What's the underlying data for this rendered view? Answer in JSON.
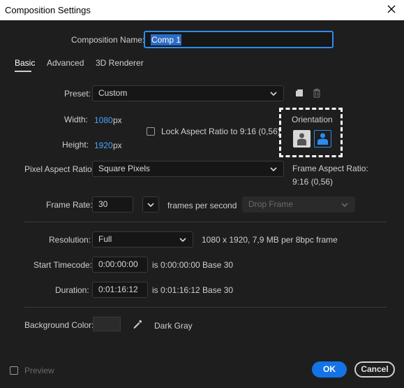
{
  "window": {
    "title": "Composition Settings"
  },
  "comp_name": {
    "label": "Composition Name:",
    "value": "Comp 1"
  },
  "tabs": [
    {
      "label": "Basic"
    },
    {
      "label": "Advanced"
    },
    {
      "label": "3D Renderer"
    }
  ],
  "preset": {
    "label": "Preset:",
    "value": "Custom"
  },
  "width": {
    "label": "Width:",
    "value": "1080",
    "unit": "px"
  },
  "height": {
    "label": "Height:",
    "value": "1920",
    "unit": "px"
  },
  "lock_aspect": {
    "label": "Lock Aspect Ratio to 9:16 (0,56)"
  },
  "orientation": {
    "label": "Orientation"
  },
  "pixel_aspect": {
    "label": "Pixel Aspect Ratio:",
    "value": "Square Pixels"
  },
  "frame_aspect": {
    "label": "Frame Aspect Ratio:",
    "value": "9:16 (0,56)"
  },
  "frame_rate": {
    "label": "Frame Rate:",
    "value": "30",
    "unit": "frames per second",
    "drop_frame": "Drop Frame"
  },
  "resolution": {
    "label": "Resolution:",
    "value": "Full",
    "info": "1080 x 1920, 7,9 MB per 8bpc frame"
  },
  "start_timecode": {
    "label": "Start Timecode:",
    "value": "0:00:00:00",
    "info": "is 0:00:00:00  Base 30"
  },
  "duration": {
    "label": "Duration:",
    "value": "0:01:16:12",
    "info": "is 0:01:16:12  Base 30"
  },
  "background": {
    "label": "Background Color:",
    "name": "Dark Gray",
    "color": "#2b2b2b"
  },
  "preview": {
    "label": "Preview"
  },
  "buttons": {
    "ok": "OK",
    "cancel": "Cancel"
  },
  "colors": {
    "accent": "#1473e6",
    "link": "#4aa3ff"
  }
}
